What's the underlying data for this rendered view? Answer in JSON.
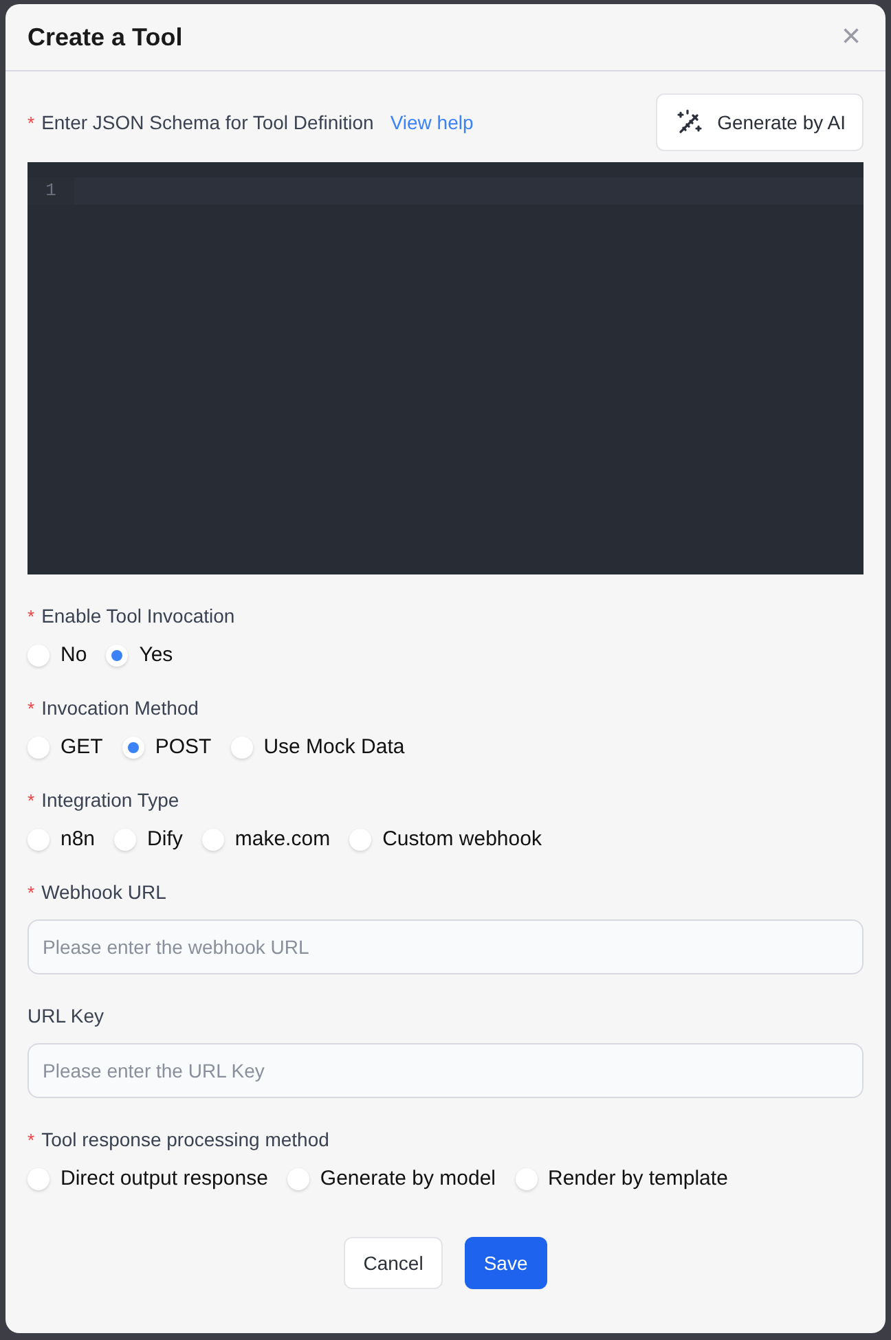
{
  "dialog": {
    "title": "Create a Tool",
    "close": "×"
  },
  "required_mark": "*",
  "schema": {
    "label": "Enter JSON Schema for Tool Definition",
    "required": true,
    "help_link": "View help",
    "generate_button": "Generate by AI",
    "line_numbers": [
      "1"
    ]
  },
  "fields": [
    {
      "kind": "radio",
      "label": "Enable Tool Invocation",
      "required": true,
      "options": [
        {
          "label": "No",
          "selected": false
        },
        {
          "label": "Yes",
          "selected": true
        }
      ]
    },
    {
      "kind": "radio",
      "label": "Invocation Method",
      "required": true,
      "options": [
        {
          "label": "GET",
          "selected": false
        },
        {
          "label": "POST",
          "selected": true
        },
        {
          "label": "Use Mock Data",
          "selected": false
        }
      ]
    },
    {
      "kind": "radio",
      "label": "Integration Type",
      "required": true,
      "options": [
        {
          "label": "n8n",
          "selected": false
        },
        {
          "label": "Dify",
          "selected": false
        },
        {
          "label": "make.com",
          "selected": false
        },
        {
          "label": "Custom webhook",
          "selected": false
        }
      ]
    },
    {
      "kind": "text",
      "label": "Webhook URL",
      "required": true,
      "placeholder": "Please enter the webhook URL"
    },
    {
      "kind": "text",
      "label": "URL Key",
      "required": false,
      "placeholder": "Please enter the URL Key"
    },
    {
      "kind": "radio",
      "label": "Tool response processing method",
      "required": true,
      "options": [
        {
          "label": "Direct output response",
          "selected": false
        },
        {
          "label": "Generate by model",
          "selected": false
        },
        {
          "label": "Render by template",
          "selected": false
        }
      ]
    }
  ],
  "buttons": [
    {
      "kind": "secondary",
      "label": "Cancel"
    },
    {
      "kind": "primary",
      "label": "Save"
    }
  ]
}
